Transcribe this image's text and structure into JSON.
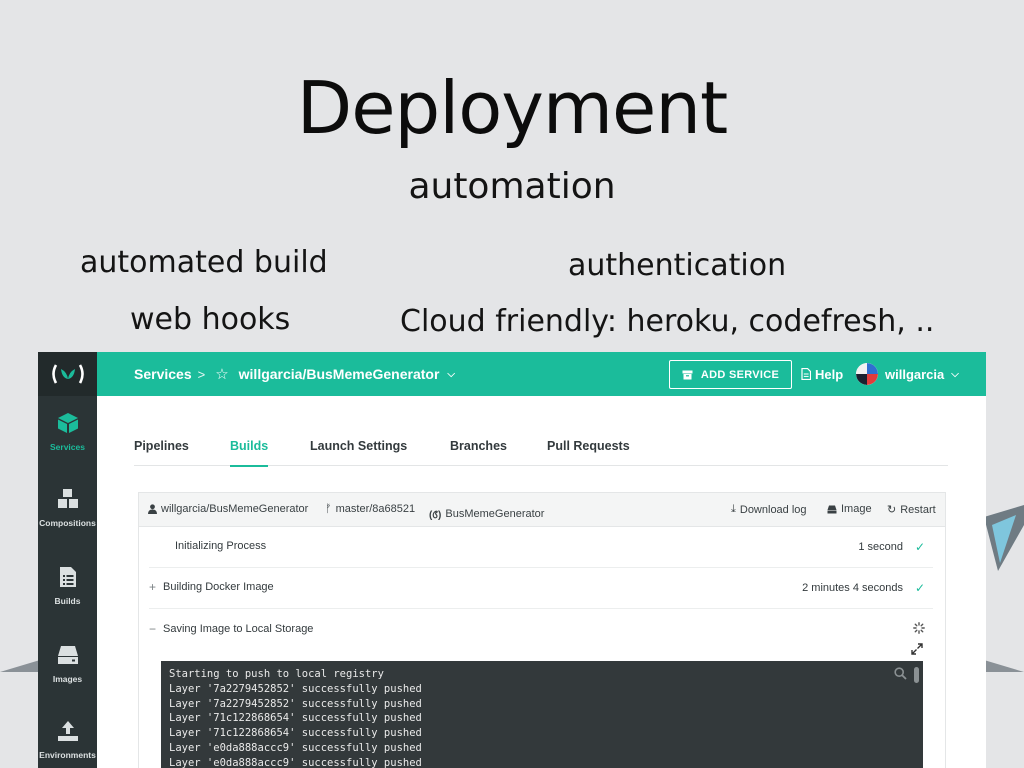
{
  "slide": {
    "title": "Deployment",
    "subtitle": "automation",
    "bullets": {
      "automated_build": "automated build",
      "web_hooks": "web hooks",
      "authentication": "authentication",
      "cloud": "Cloud friendly: heroku, codefresh, .."
    }
  },
  "app": {
    "colors": {
      "accent": "#1bbc9b",
      "sidebar": "#2b3436",
      "console": "#33393b"
    },
    "topbar": {
      "breadcrumb_root": "Services",
      "breadcrumb_sep": ">",
      "repo": "willgarcia/BusMemeGenerator",
      "add_service": "ADD SERVICE",
      "help": "Help",
      "user": "willgarcia"
    },
    "sidebar": [
      {
        "label": "Services",
        "icon": "cube-icon",
        "active": true
      },
      {
        "label": "Compositions",
        "icon": "cubes-icon",
        "active": false
      },
      {
        "label": "Builds",
        "icon": "list-icon",
        "active": false
      },
      {
        "label": "Images",
        "icon": "drive-icon",
        "active": false
      },
      {
        "label": "Environments",
        "icon": "upload-icon",
        "active": false
      }
    ],
    "tabs": [
      "Pipelines",
      "Builds",
      "Launch Settings",
      "Branches",
      "Pull Requests"
    ],
    "active_tab": "Builds",
    "build": {
      "repo": "willgarcia/BusMemeGenerator",
      "branch": "master/8a68521",
      "service": "BusMemeGenerator",
      "download_log": "Download log",
      "image": "Image",
      "restart": "Restart",
      "steps": [
        {
          "toggle": "",
          "label": "Initializing Process",
          "duration": "1 second",
          "status": "done"
        },
        {
          "toggle": "+",
          "label": "Building Docker Image",
          "duration": "2 minutes 4 seconds",
          "status": "done"
        },
        {
          "toggle": "−",
          "label": "Saving Image to Local Storage",
          "duration": "",
          "status": "running"
        }
      ],
      "log": [
        "Starting to push to local registry",
        "Layer '7a2279452852' successfully pushed",
        "Layer '7a2279452852' successfully pushed",
        "Layer '71c122868654' successfully pushed",
        "Layer '71c122868654' successfully pushed",
        "Layer 'e0da888accc9' successfully pushed",
        "Layer 'e0da888accc9' successfully pushed"
      ]
    }
  }
}
